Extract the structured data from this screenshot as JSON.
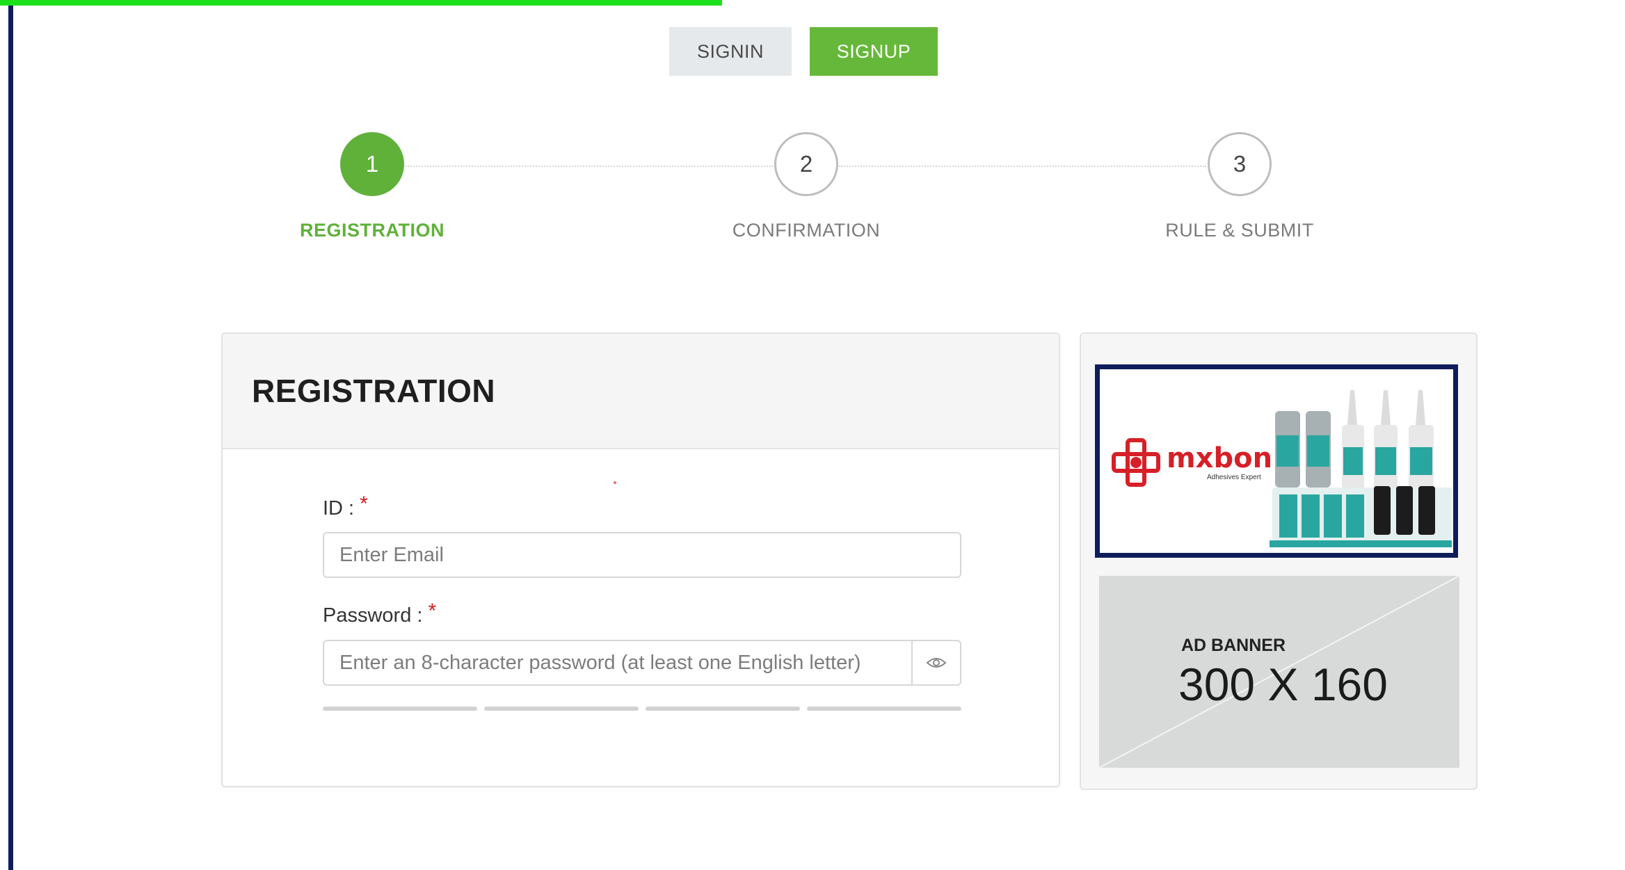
{
  "auth": {
    "signin_label": "SIGNIN",
    "signup_label": "SIGNUP",
    "active": "signup"
  },
  "steps": [
    {
      "number": "1",
      "label": "REGISTRATION",
      "active": true
    },
    {
      "number": "2",
      "label": "CONFIRMATION",
      "active": false
    },
    {
      "number": "3",
      "label": "RULE & SUBMIT",
      "active": false
    }
  ],
  "registration": {
    "title": "REGISTRATION",
    "id_label": "ID :",
    "id_required": "*",
    "id_placeholder": "Enter Email",
    "password_label": "Password :",
    "password_required": "*",
    "password_placeholder": "Enter an 8-character password (at least one English letter)",
    "password_strength_segments": 4
  },
  "sidebar": {
    "brand_ad": {
      "brand": "mxbon",
      "tagline": "Adhesives Expert"
    },
    "placeholder_ad": {
      "caption": "AD BANNER",
      "size": "300 X 160"
    }
  },
  "colors": {
    "accent_green": "#5fb13a",
    "signup_green": "#66b83a",
    "top_bar_green": "#1de01d",
    "frame_navy": "#0f1d5a",
    "required_red": "#d42020",
    "brand_red": "#d62027"
  },
  "icons": {
    "password_toggle": "eye-icon",
    "brand_mark": "mxbon-logo-icon"
  }
}
